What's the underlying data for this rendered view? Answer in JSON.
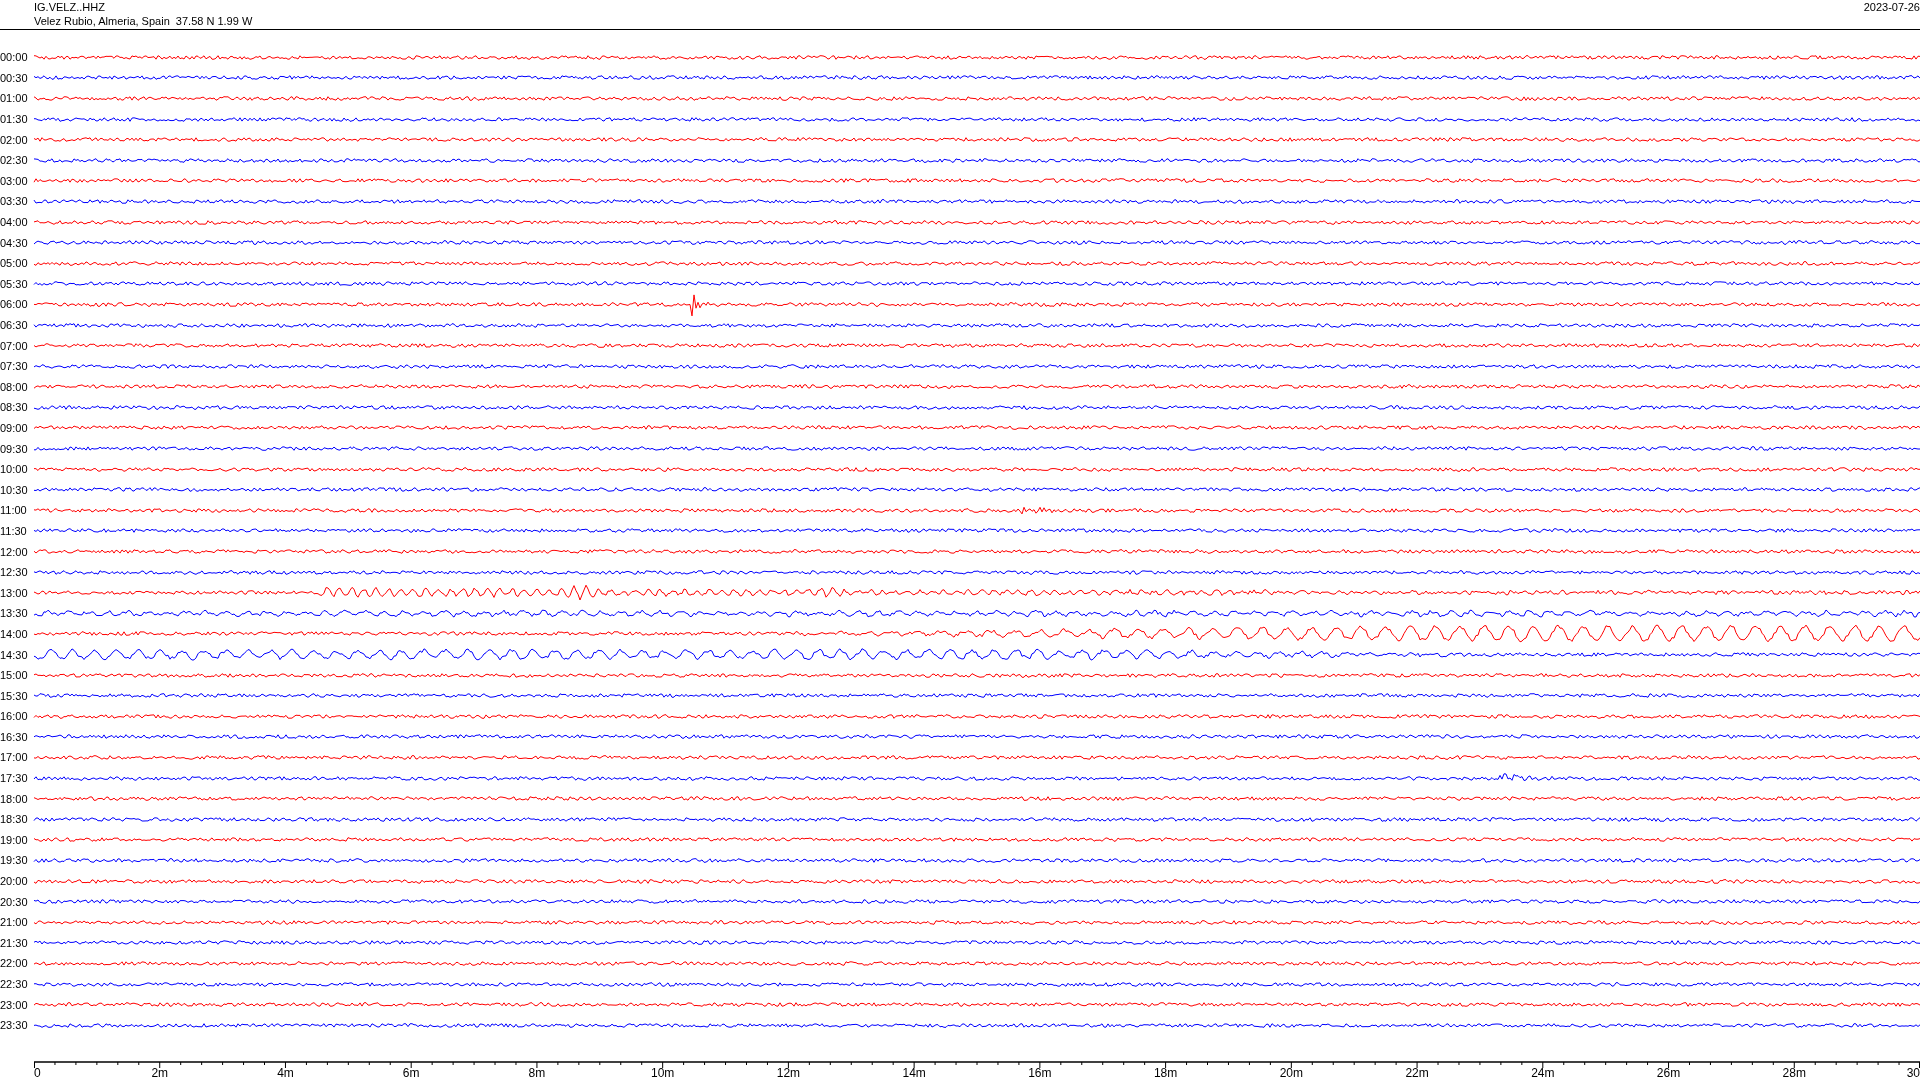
{
  "header": {
    "station": "IG.VELZ..HHZ",
    "location": "Velez Rubio, Almeria, Spain  37.58 N 1.99 W",
    "date": "2023-07-26"
  },
  "rows": [
    {
      "label": "00:00",
      "color": "#ff0000"
    },
    {
      "label": "00:30",
      "color": "#0000ff"
    },
    {
      "label": "01:00",
      "color": "#ff0000"
    },
    {
      "label": "01:30",
      "color": "#0000ff"
    },
    {
      "label": "02:00",
      "color": "#ff0000"
    },
    {
      "label": "02:30",
      "color": "#0000ff"
    },
    {
      "label": "03:00",
      "color": "#ff0000"
    },
    {
      "label": "03:30",
      "color": "#0000ff"
    },
    {
      "label": "04:00",
      "color": "#ff0000"
    },
    {
      "label": "04:30",
      "color": "#0000ff"
    },
    {
      "label": "05:00",
      "color": "#ff0000"
    },
    {
      "label": "05:30",
      "color": "#0000ff"
    },
    {
      "label": "06:00",
      "color": "#ff0000"
    },
    {
      "label": "06:30",
      "color": "#0000ff"
    },
    {
      "label": "07:00",
      "color": "#ff0000"
    },
    {
      "label": "07:30",
      "color": "#0000ff"
    },
    {
      "label": "08:00",
      "color": "#ff0000"
    },
    {
      "label": "08:30",
      "color": "#0000ff"
    },
    {
      "label": "09:00",
      "color": "#ff0000"
    },
    {
      "label": "09:30",
      "color": "#0000ff"
    },
    {
      "label": "10:00",
      "color": "#ff0000"
    },
    {
      "label": "10:30",
      "color": "#0000ff"
    },
    {
      "label": "11:00",
      "color": "#ff0000"
    },
    {
      "label": "11:30",
      "color": "#0000ff"
    },
    {
      "label": "12:00",
      "color": "#ff0000"
    },
    {
      "label": "12:30",
      "color": "#0000ff"
    },
    {
      "label": "13:00",
      "color": "#ff0000"
    },
    {
      "label": "13:30",
      "color": "#0000ff"
    },
    {
      "label": "14:00",
      "color": "#ff0000"
    },
    {
      "label": "14:30",
      "color": "#0000ff"
    },
    {
      "label": "15:00",
      "color": "#ff0000"
    },
    {
      "label": "15:30",
      "color": "#0000ff"
    },
    {
      "label": "16:00",
      "color": "#ff0000"
    },
    {
      "label": "16:30",
      "color": "#0000ff"
    },
    {
      "label": "17:00",
      "color": "#ff0000"
    },
    {
      "label": "17:30",
      "color": "#0000ff"
    },
    {
      "label": "18:00",
      "color": "#ff0000"
    },
    {
      "label": "18:30",
      "color": "#0000ff"
    },
    {
      "label": "19:00",
      "color": "#ff0000"
    },
    {
      "label": "19:30",
      "color": "#0000ff"
    },
    {
      "label": "20:00",
      "color": "#ff0000"
    },
    {
      "label": "20:30",
      "color": "#0000ff"
    },
    {
      "label": "21:00",
      "color": "#ff0000"
    },
    {
      "label": "21:30",
      "color": "#0000ff"
    },
    {
      "label": "22:00",
      "color": "#ff0000"
    },
    {
      "label": "22:30",
      "color": "#0000ff"
    },
    {
      "label": "23:00",
      "color": "#ff0000"
    },
    {
      "label": "23:30",
      "color": "#0000ff"
    }
  ],
  "x_axis": {
    "tick_labels": [
      "0",
      "2m",
      "4m",
      "6m",
      "8m",
      "10m",
      "12m",
      "14m",
      "16m",
      "18m",
      "20m",
      "22m",
      "24m",
      "26m",
      "28m",
      "30"
    ]
  }
}
